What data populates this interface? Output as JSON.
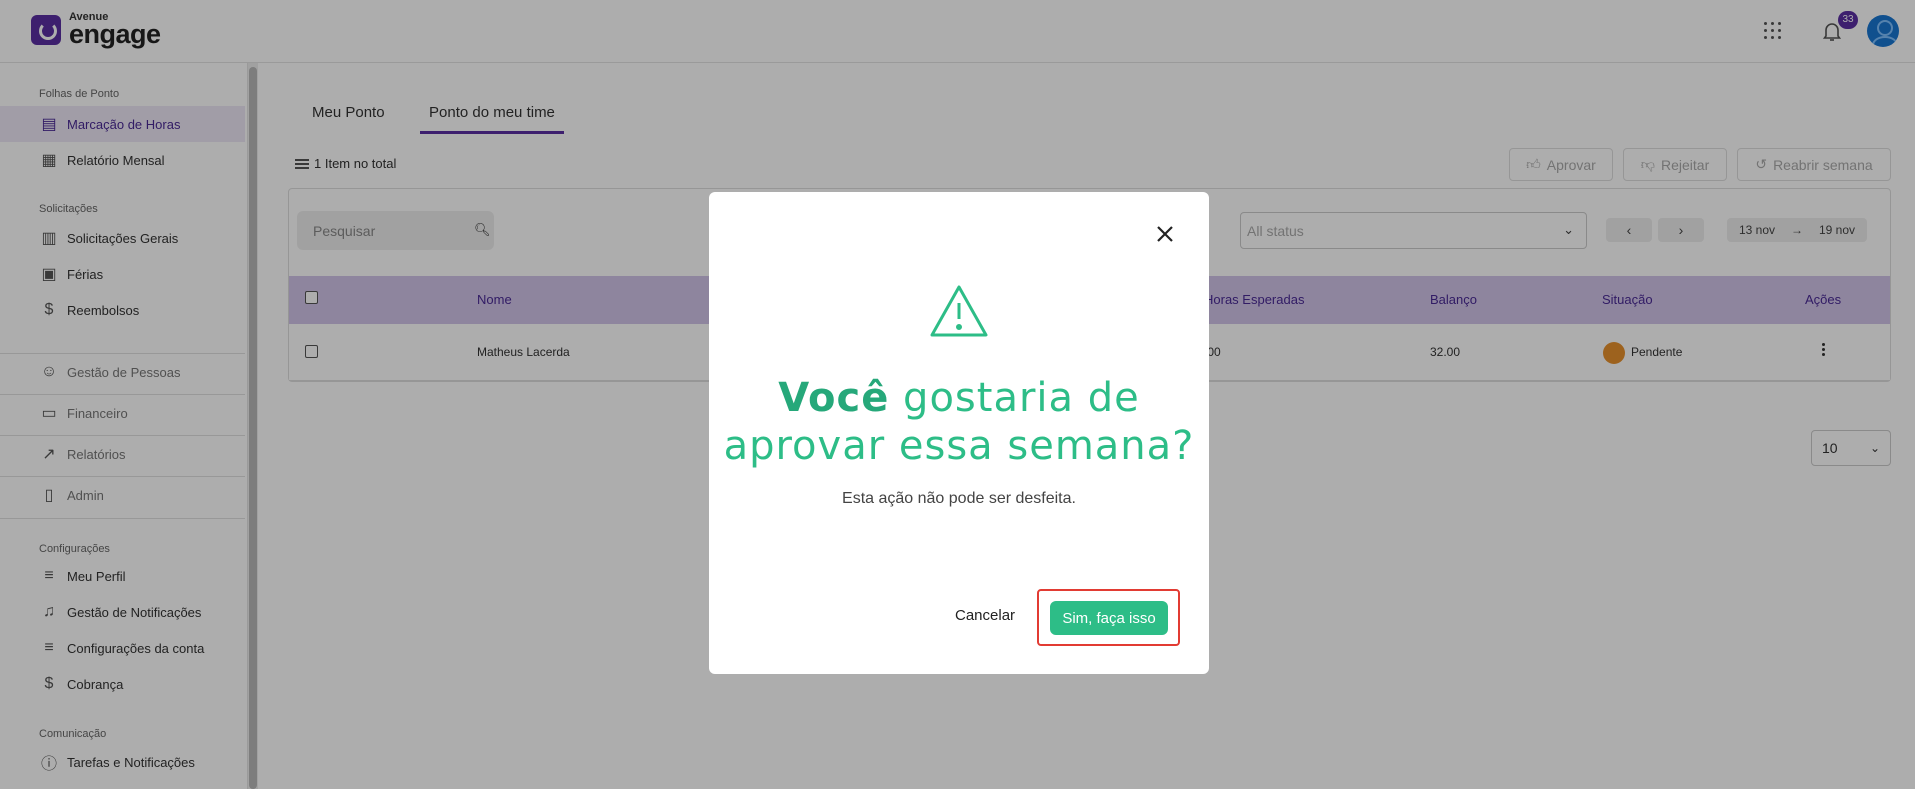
{
  "header": {
    "logo_small": "Avenue",
    "logo_big": "engage",
    "notifications_count": "33"
  },
  "sidebar": {
    "sections": {
      "folhas": "Folhas de Ponto",
      "solicitacoes": "Solicitações",
      "configuracoes": "Configurações",
      "comunicacao": "Comunicação"
    },
    "items": {
      "marcacao": "Marcação de Horas",
      "relatorio_mensal": "Relatório Mensal",
      "solicitacoes_gerais": "Solicitações Gerais",
      "ferias": "Férias",
      "reembolsos": "Reembolsos",
      "gestao_pessoas": "Gestão de Pessoas",
      "financeiro": "Financeiro",
      "relatorios": "Relatórios",
      "admin": "Admin",
      "meu_perfil": "Meu Perfil",
      "gestao_notificacoes": "Gestão de Notificações",
      "config_conta": "Configurações da conta",
      "cobranca": "Cobrança",
      "tarefas": "Tarefas e Notificações"
    }
  },
  "main": {
    "tabs": {
      "meu_ponto": "Meu Ponto",
      "ponto_time": "Ponto do meu time"
    },
    "total": "1 Item no total",
    "actions": {
      "aprovar": "Aprovar",
      "rejeitar": "Rejeitar",
      "reabrir": "Reabrir semana"
    },
    "search_placeholder": "Pesquisar",
    "status_placeholder": "All status",
    "date_from": "13 nov",
    "date_to": "19 nov",
    "columns": {
      "nome": "Nome",
      "horas_esperadas": "Horas Esperadas",
      "balanco": "Balanço",
      "situacao": "Situação",
      "acoes": "Ações"
    },
    "row": {
      "nome": "Matheus Lacerda",
      "horas_esperadas": ".00",
      "balanco": "32.00",
      "situacao": "Pendente"
    },
    "page_size": "10"
  },
  "modal": {
    "title_bold": "Você",
    "title_rest": " gostaria de aprovar essa semana?",
    "subtitle": "Esta ação não pode ser desfeita.",
    "cancel": "Cancelar",
    "confirm": "Sim, faça isso"
  },
  "colors": {
    "brand": "#5b2fa3",
    "accent_green": "#2dbd87",
    "pending": "#e8912d",
    "highlight": "#e23b33"
  }
}
